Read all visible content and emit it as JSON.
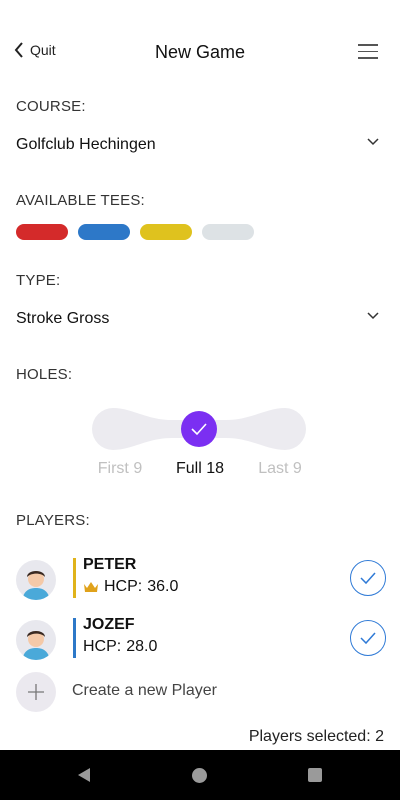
{
  "header": {
    "back_label": "Quit",
    "title": "New Game"
  },
  "course": {
    "label": "COURSE:",
    "value": "Golfclub Hechingen"
  },
  "tees": {
    "label": "AVAILABLE TEES:",
    "colors": [
      "#d42a2a",
      "#2d78c8",
      "#dfc21e",
      "#dde2e5"
    ]
  },
  "type": {
    "label": "TYPE:",
    "value": "Stroke Gross"
  },
  "holes": {
    "label": "HOLES:",
    "options": [
      "First 9",
      "Full 18",
      "Last 9"
    ],
    "selected": "Full 18",
    "accent": "#7b2ff2"
  },
  "players": {
    "label": "PLAYERS:",
    "list": [
      {
        "name": "PETER",
        "hcp_label": "HCP:",
        "hcp": "36.0",
        "bar_color": "#e0b31b",
        "crown": true,
        "checked": true
      },
      {
        "name": "JOZEF",
        "hcp_label": "HCP:",
        "hcp": "28.0",
        "bar_color": "#2d78c8",
        "crown": false,
        "checked": true
      }
    ],
    "create_label": "Create a new Player",
    "selected_text": "Players selected: 2"
  }
}
